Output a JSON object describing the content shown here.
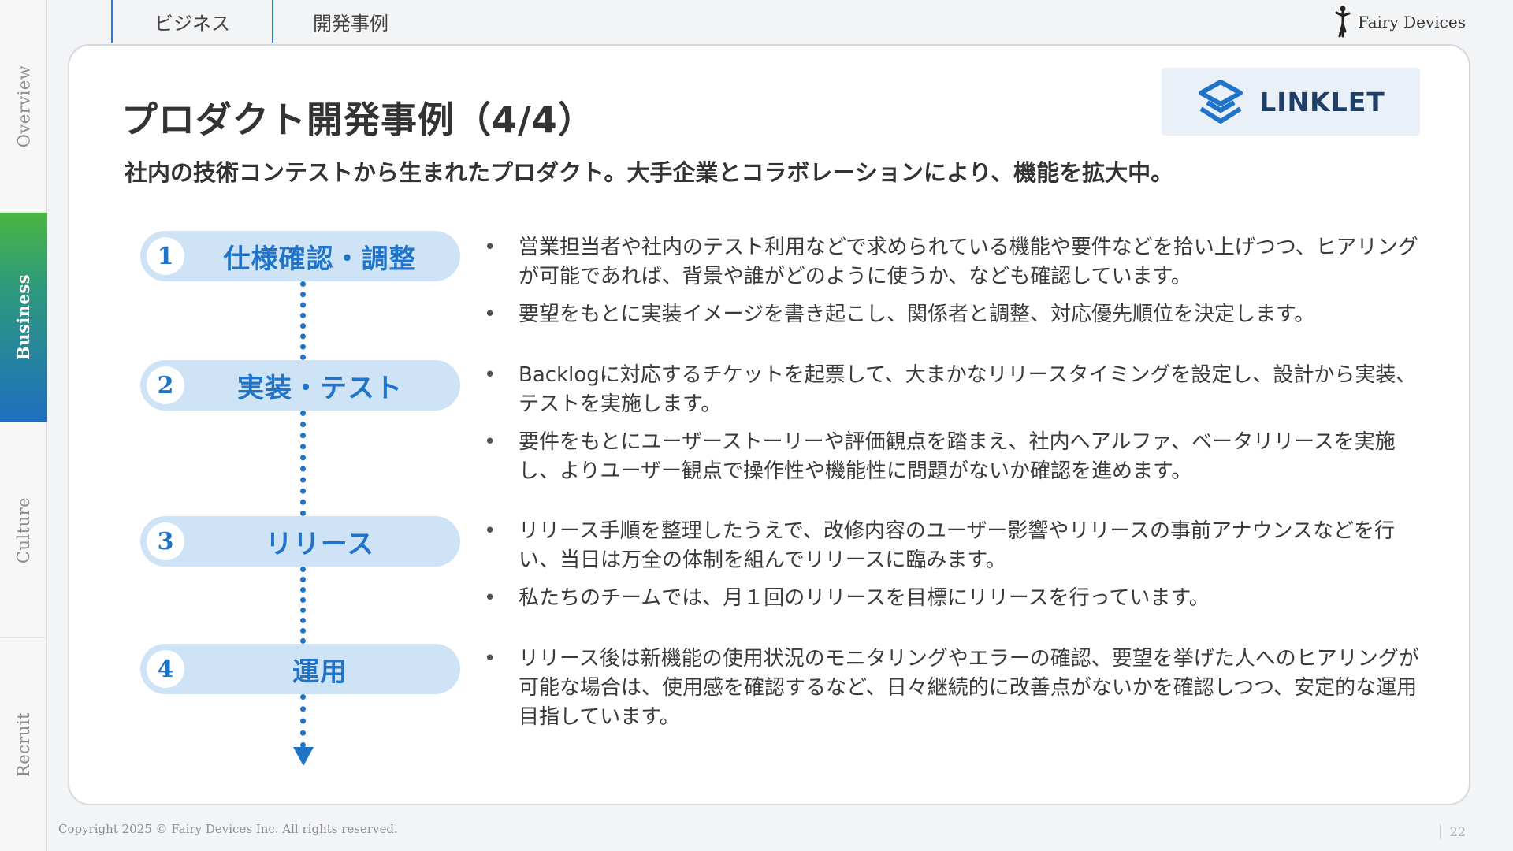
{
  "sidenav": {
    "items": [
      {
        "label": "Overview"
      },
      {
        "label": "Business"
      },
      {
        "label": "Culture"
      },
      {
        "label": "Recruit"
      }
    ]
  },
  "tabs": [
    {
      "label": "ビジネス"
    },
    {
      "label": "開発事例"
    }
  ],
  "brand": {
    "name": "Fairy Devices"
  },
  "logo": {
    "text": "LINKLET"
  },
  "page": {
    "title": "プロダクト開発事例（4/4）",
    "subtitle": "社内の技術コンテストから生まれたプロダクト。大手企業とコラボレーションにより、機能を拡大中。"
  },
  "steps": [
    {
      "number": "1",
      "label": "仕様確認・調整"
    },
    {
      "number": "2",
      "label": "実装・テスト"
    },
    {
      "number": "3",
      "label": "リリース"
    },
    {
      "number": "4",
      "label": "運用"
    }
  ],
  "bullets": [
    {
      "text": "営業担当者や社内のテスト利用などで求められている機能や要件などを拾い上げつつ、ヒアリングが可能であれば、背景や誰がどのように使うか、なども確認しています。"
    },
    {
      "text": "要望をもとに実装イメージを書き起こし、関係者と調整、対応優先順位を決定します。"
    },
    {
      "text": "Backlogに対応するチケットを起票して、大まかなリリースタイミングを設定し、設計から実装、テストを実施します。"
    },
    {
      "text": "要件をもとにユーザーストーリーや評価観点を踏まえ、社内へアルファ、ベータリリースを実施し、よりユーザー観点で操作性や機能性に問題がないか確認を進めます。"
    },
    {
      "text": "リリース手順を整理したうえで、改修内容のユーザー影響やリリースの事前アナウンスなどを行い、当日は万全の体制を組んでリリースに臨みます。"
    },
    {
      "text": "私たちのチームでは、月１回のリリースを目標にリリースを行っています。"
    },
    {
      "text": "リリース後は新機能の使用状況のモニタリングやエラーの確認、要望を挙げた人へのヒアリングが可能な場合は、使用感を確認するなど、日々継続的に改善点がないかを確認しつつ、安定的な運用目指しています。"
    }
  ],
  "bullet_marker": "•",
  "footer": {
    "copyright": "Copyright 2025 © Fairy Devices Inc. All rights reserved.",
    "page_number": "22"
  },
  "colors": {
    "accent": "#1f73c8",
    "pill": "#cfe3f7",
    "logo_bg": "#e9f0f8",
    "active_nav_top": "#4bb543",
    "active_nav_bottom": "#1f6fc0"
  }
}
